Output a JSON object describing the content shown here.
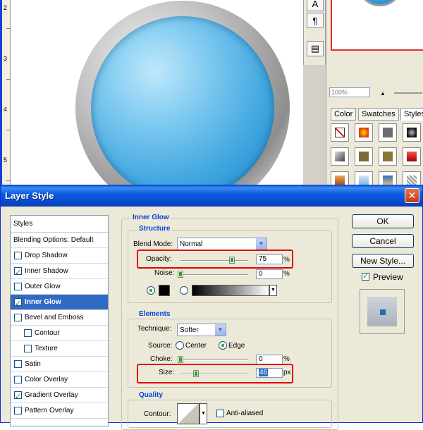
{
  "ruler": {
    "marks": [
      "2",
      "3",
      "4",
      "5"
    ]
  },
  "navigator": {
    "zoom": "100%"
  },
  "panel_tabs": [
    "Color",
    "Swatches",
    "Styles"
  ],
  "dialog": {
    "title": "Layer Style",
    "close_glyph": "✕",
    "style_list": {
      "header": "Styles",
      "blending": "Blending Options: Default",
      "items": [
        {
          "label": "Drop Shadow",
          "checked": false,
          "selected": false
        },
        {
          "label": "Inner Shadow",
          "checked": true,
          "selected": false
        },
        {
          "label": "Outer Glow",
          "checked": false,
          "selected": false
        },
        {
          "label": "Inner Glow",
          "checked": true,
          "selected": true
        },
        {
          "label": "Bevel and Emboss",
          "checked": false,
          "selected": false
        },
        {
          "label": "Contour",
          "checked": false,
          "selected": false
        },
        {
          "label": "Texture",
          "checked": false,
          "selected": false
        },
        {
          "label": "Satin",
          "checked": false,
          "selected": false
        },
        {
          "label": "Color Overlay",
          "checked": false,
          "selected": false
        },
        {
          "label": "Gradient Overlay",
          "checked": true,
          "selected": false
        },
        {
          "label": "Pattern Overlay",
          "checked": false,
          "selected": false
        }
      ]
    },
    "inner_glow": {
      "section_title": "Inner Glow",
      "structure": {
        "title": "Structure",
        "blend_mode_label": "Blend Mode:",
        "blend_mode_value": "Normal",
        "opacity_label": "Opacity:",
        "opacity_value": "75",
        "noise_label": "Noise:",
        "noise_value": "0",
        "percent": "%"
      },
      "elements": {
        "title": "Elements",
        "technique_label": "Technique:",
        "technique_value": "Softer",
        "source_label": "Source:",
        "source_center": "Center",
        "source_edge": "Edge",
        "choke_label": "Choke:",
        "choke_value": "0",
        "size_label": "Size:",
        "size_value": "46",
        "px": "px",
        "percent": "%"
      },
      "quality": {
        "title": "Quality",
        "contour_label": "Contour:",
        "anti_aliased_label": "Anti-aliased"
      }
    },
    "buttons": {
      "ok": "OK",
      "cancel": "Cancel",
      "new_style": "New Style...",
      "preview_label": "Preview"
    },
    "colors": {
      "accent": "#316ac5",
      "highlight_box": "#e00000",
      "title_bar": "#0a5fdc"
    }
  }
}
